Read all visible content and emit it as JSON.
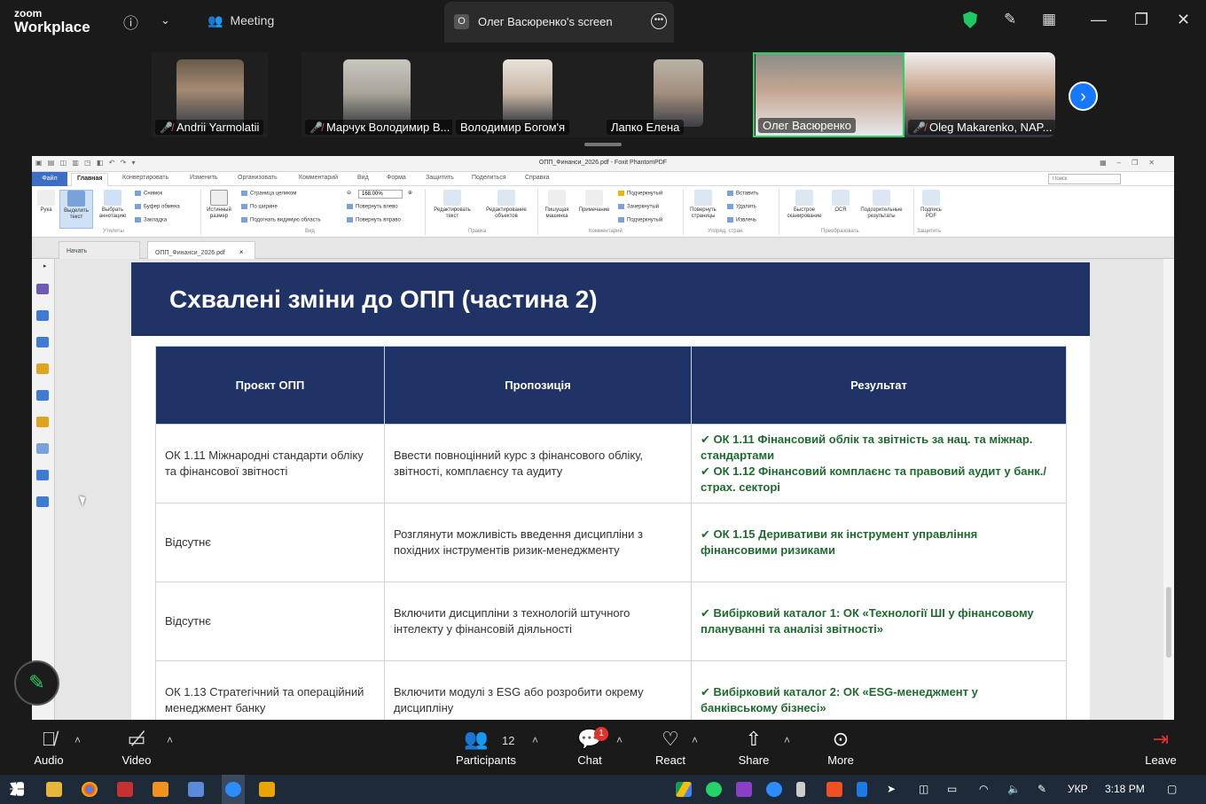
{
  "zoom": {
    "logo_line1": "zoom",
    "logo_line2": "Workplace",
    "meeting_label": "Meeting",
    "share_badge": "O",
    "share_title": "Олег Васюренко's screen"
  },
  "participants_strip": [
    {
      "name": "Andrii Yarmolatii",
      "muted": true
    },
    {
      "name": "Марчук Володимир В...",
      "muted": true
    },
    {
      "name": "Володимир Богом'я",
      "muted": false
    },
    {
      "name": "Лапко Елена",
      "muted": false
    },
    {
      "name": "Олег Васюренко",
      "muted": false,
      "active": true
    },
    {
      "name": "Oleg Makarenko, NAP...",
      "muted": true
    }
  ],
  "foxit": {
    "window_title": "ОПП_Финанси_2026.pdf - Foxit PhantomPDF",
    "tabs": [
      "Файл",
      "Главная",
      "Конвертировать",
      "Изменить",
      "Организовать",
      "Комментарий",
      "Вид",
      "Форма",
      "Защитить",
      "Поделиться",
      "Справка"
    ],
    "search_placeholder": "Поиск",
    "zoom_value": "168.00%",
    "buttons": {
      "hand": "Рука",
      "select_text": "Выделить текст",
      "select_annot": "Выбрать аннотацию",
      "actual_size": "Истинный размер",
      "edit_text": "Редактировать текст",
      "edit_objects": "Редактирование объектов",
      "typewriter": "Пишущая машинка",
      "note": "Примечание",
      "rotate_pages": "Повернуть страницы",
      "quick_scan": "Быстрое сканирование",
      "ocr": "OCR",
      "suspect": "Подозрительные результаты",
      "sign_pdf": "Подпись PDF"
    },
    "small": {
      "snapshot": "Снимок",
      "clipboard": "Буфер обмена",
      "bookmark": "Закладка",
      "full_page": "Страница целиком",
      "fit_width": "По ширине",
      "fit_visible": "Подогнать видимую область",
      "rotate_left": "Повернуть влево",
      "rotate_right": "Повернуть вправо",
      "highlight": "Подчеркнутый",
      "strikeout": "Зачеркнутый",
      "underline": "Подчеркнутый",
      "insert": "Вставить",
      "delete": "Удалить",
      "extract": "Извлечь"
    },
    "groups": {
      "tools": "Утилиты",
      "view": "Вид",
      "edit": "Правка",
      "comment": "Комментарий",
      "pages": "Упоряд. стран.",
      "convert": "Преобразовать",
      "protect": "Защитить"
    },
    "doc_tabs": [
      "Начать",
      "ОПП_Финанси_2026.pdf"
    ]
  },
  "slide": {
    "title": "Схвалені зміни до ОПП (частина 2)",
    "headers": [
      "Проєкт ОПП",
      "Пропозиція",
      "Результат"
    ],
    "rows": [
      {
        "project": "ОК 1.11 Міжнародні стандарти обліку та фінансової звітності",
        "proposal": "Ввести повноцінний курс з фінансового обліку, звітності, комплаєнсу та аудиту",
        "result": [
          "✔ ОК 1.11 Фінансовий облік та звітність за нац. та міжнар. стандартами",
          "✔ ОК 1.12 Фінансовий комплаєнс та правовий аудит у банк./страх. секторі"
        ]
      },
      {
        "project": "Відсутнє",
        "proposal": "Розглянути можливість введення дисципліни з похідних інструментів ризик-менеджменту",
        "result": [
          "✔ ОК 1.15 Деривативи як інструмент управління фінансовими ризиками"
        ]
      },
      {
        "project": "Відсутнє",
        "proposal": "Включити дисципліни з технологій штучного інтелекту у фінансовій діяльності",
        "result": [
          "✔ Вибірковий каталог 1: ОК «Технології ШІ у фінансовому плануванні та аналізі звітності»"
        ]
      },
      {
        "project": "ОК 1.13 Стратегічний та операційний менеджмент банку",
        "proposal": "Включити модулі з ESG або розробити окрему дисципліну",
        "result": [
          "✔ Вибірковий каталог 2: ОК «ESG-менеджмент у банківському бізнесі»"
        ]
      }
    ]
  },
  "toolbar": {
    "audio": "Audio",
    "video": "Video",
    "participants": "Participants",
    "participants_count": "12",
    "chat": "Chat",
    "chat_badge": "1",
    "react": "React",
    "share": "Share",
    "more": "More",
    "leave": "Leave"
  },
  "taskbar": {
    "lang": "УКР",
    "time": "3:18 PM"
  },
  "colors": {
    "slide_navy": "#203366",
    "result_green": "#1e6b2e",
    "active_speaker": "#2bd163",
    "leave_red": "#e0332d"
  }
}
